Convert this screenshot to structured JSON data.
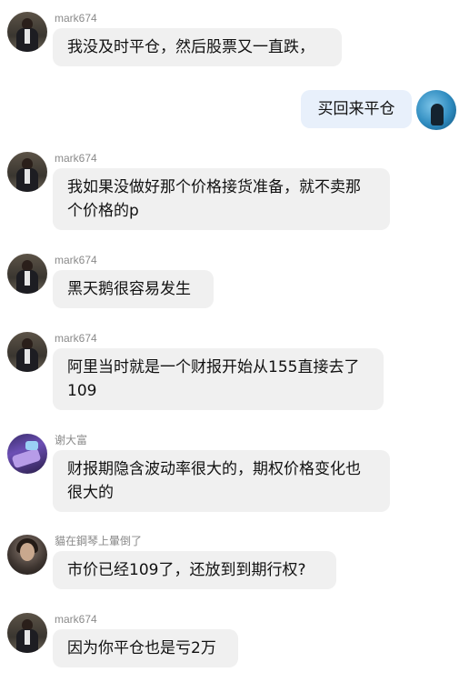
{
  "messages": [
    {
      "sender": "mark674",
      "text": "我没及时平仓，然后股票又一直跌，",
      "avatar": "user-avatar-mark674"
    },
    {
      "sender": "",
      "text": "买回来平仓",
      "avatar": "self-avatar"
    },
    {
      "sender": "mark674",
      "text": "我如果没做好那个价格接货准备，就不卖那个价格的p",
      "avatar": "user-avatar-mark674"
    },
    {
      "sender": "mark674",
      "text": "黑天鹅很容易发生",
      "avatar": "user-avatar-mark674"
    },
    {
      "sender": "mark674",
      "text": "阿里当时就是一个财报开始从155直接去了109",
      "avatar": "user-avatar-mark674"
    },
    {
      "sender": "谢大富",
      "text": "财报期隐含波动率很大的，期权价格变化也很大的",
      "avatar": "user-avatar-xie"
    },
    {
      "sender": "貓在鋼琴上暈倒了",
      "text": "市价已经109了，还放到到期行权?",
      "avatar": "user-avatar-mao"
    },
    {
      "sender": "mark674",
      "text": "因为你平仓也是亏2万",
      "avatar": "user-avatar-mark674"
    }
  ],
  "colors": {
    "incoming_bubble": "#f0f0f0",
    "outgoing_bubble": "#e8f0fb",
    "sender_name": "#8a8a8a"
  }
}
